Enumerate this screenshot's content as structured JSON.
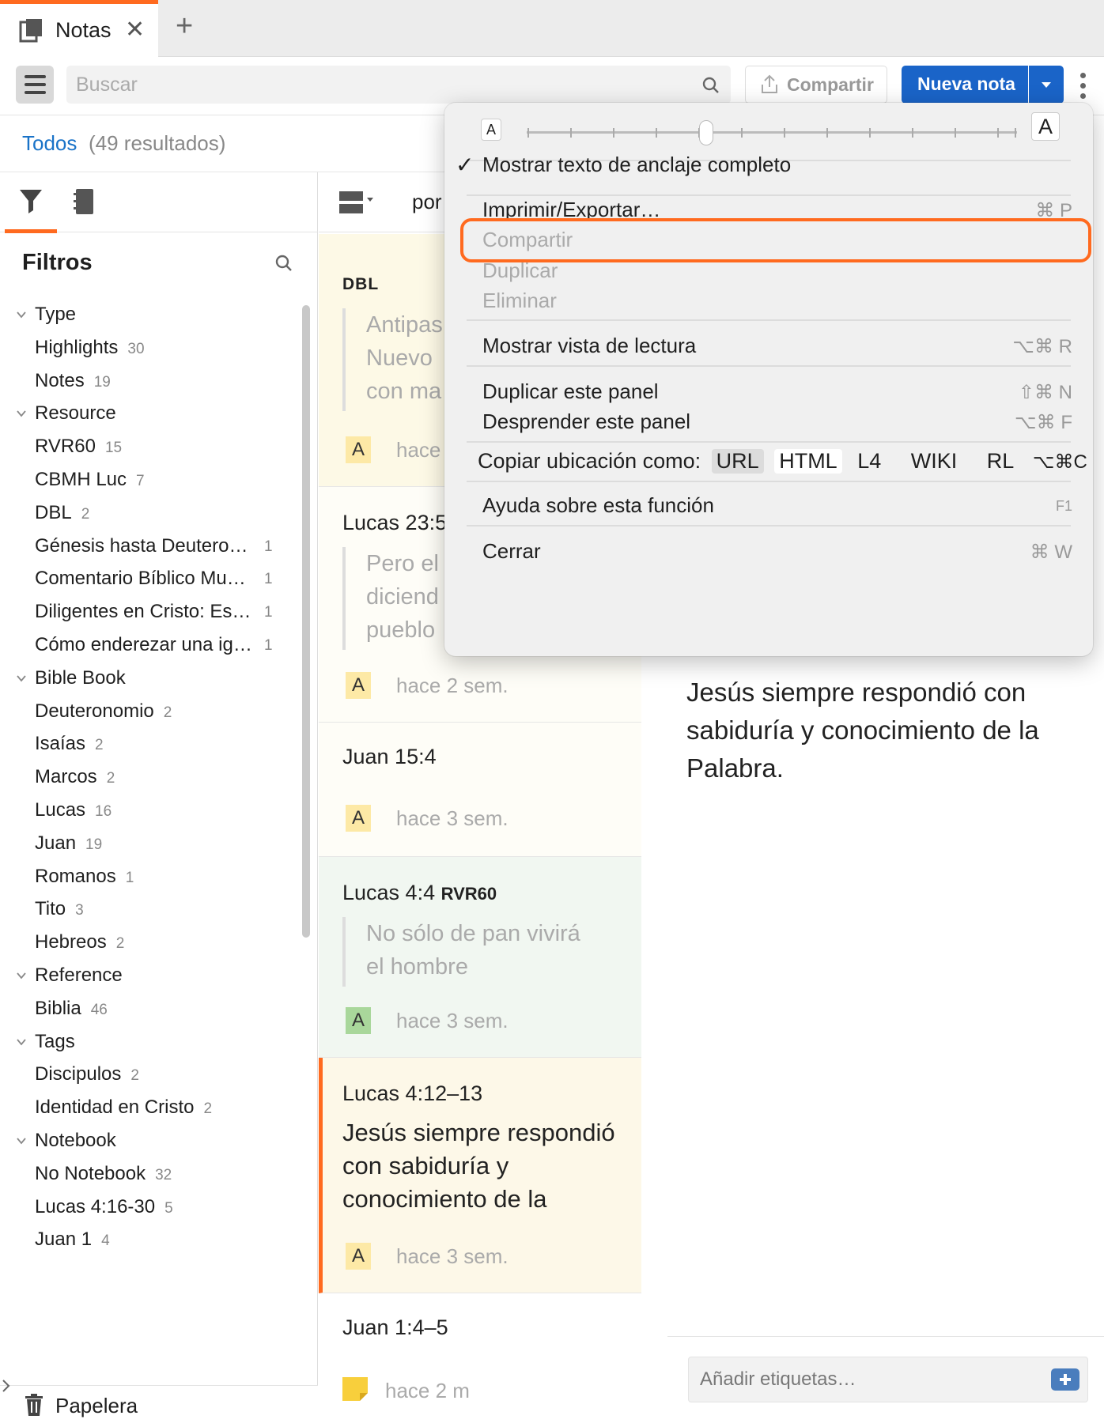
{
  "tab": {
    "title": "Notas",
    "close": "✕",
    "new": "+"
  },
  "toolbar": {
    "search_placeholder": "Buscar",
    "share_label": "Compartir",
    "new_note_label": "Nueva nota"
  },
  "scope": {
    "label": "Todos",
    "count": "(49 resultados)"
  },
  "sidebar": {
    "title": "Filtros",
    "trash_label": "Papelera",
    "groups": [
      {
        "label": "Type",
        "items": [
          {
            "label": "Highlights",
            "count": "30"
          },
          {
            "label": "Notes",
            "count": "19"
          }
        ]
      },
      {
        "label": "Resource",
        "items": [
          {
            "label": "RVR60",
            "count": "15"
          },
          {
            "label": "CBMH Luc",
            "count": "7"
          },
          {
            "label": "DBL",
            "count": "2"
          },
          {
            "label": "Génesis hasta Deutero…",
            "count": "1"
          },
          {
            "label": "Comentario Bíblico Mu…",
            "count": "1"
          },
          {
            "label": "Diligentes en Cristo: Es…",
            "count": "1"
          },
          {
            "label": "Cómo enderezar una ig…",
            "count": "1"
          }
        ]
      },
      {
        "label": "Bible Book",
        "items": [
          {
            "label": "Deuteronomio",
            "count": "2"
          },
          {
            "label": "Isaías",
            "count": "2"
          },
          {
            "label": "Marcos",
            "count": "2"
          },
          {
            "label": "Lucas",
            "count": "16"
          },
          {
            "label": "Juan",
            "count": "19"
          },
          {
            "label": "Romanos",
            "count": "1"
          },
          {
            "label": "Tito",
            "count": "3"
          },
          {
            "label": "Hebreos",
            "count": "2"
          }
        ]
      },
      {
        "label": "Reference",
        "items": [
          {
            "label": "Biblia",
            "count": "46"
          }
        ]
      },
      {
        "label": "Tags",
        "items": [
          {
            "label": "Discipulos",
            "count": "2"
          },
          {
            "label": "Identidad en Cristo",
            "count": "2"
          }
        ]
      },
      {
        "label": "Notebook",
        "items": [
          {
            "label": "No Notebook",
            "count": "32"
          },
          {
            "label": "Lucas 4:16-30",
            "count": "5"
          },
          {
            "label": "Juan 1",
            "count": "4"
          }
        ]
      }
    ]
  },
  "list": {
    "sort_label": "por",
    "cards": [
      {
        "ref": "DBL",
        "quote": [
          "Antipas",
          "Nuevo",
          "con ma"
        ],
        "badge": "A",
        "when": "hace"
      },
      {
        "ref": "Lucas 23:5",
        "quote": [
          "Pero el",
          "diciend",
          "pueblo"
        ],
        "badge": "A",
        "when": "hace 2 sem."
      },
      {
        "ref": "Juan 15:4",
        "badge": "A",
        "when": "hace 3 sem."
      },
      {
        "ref": "Lucas 4:4",
        "ref_tag": "RVR60",
        "quote": [
          "No sólo de pan vivirá",
          "el hombre"
        ],
        "badge": "A",
        "when": "hace 3 sem."
      },
      {
        "ref": "Lucas 4:12–13",
        "body": [
          "Jesús siempre respondió",
          "con sabiduría y",
          "conocimiento de la"
        ],
        "badge": "A",
        "when": "hace 3 sem."
      },
      {
        "ref": "Juan 1:4–5",
        "when": "hace 2 m"
      }
    ]
  },
  "detail": {
    "text": "Jesús siempre respondió con sabiduría y conocimiento de la Palabra.",
    "tags_placeholder": "Añadir etiquetas…"
  },
  "menu": {
    "font_small": "A",
    "font_large": "A",
    "show_anchor": "Mostrar texto de anclaje completo",
    "check": "✓",
    "print": "Imprimir/Exportar…",
    "print_sc": "⌘ P",
    "share": "Compartir",
    "duplicate": "Duplicar",
    "delete": "Eliminar",
    "reading": "Mostrar vista de lectura",
    "reading_sc": "⌥⌘ R",
    "dup_panel": "Duplicar este panel",
    "dup_panel_sc": "⇧⌘ N",
    "detach": "Desprender este panel",
    "detach_sc": "⌥⌘ F",
    "copy_loc": "Copiar ubicación como:",
    "copy_opts": [
      "URL",
      "HTML",
      "L4",
      "WIKI",
      "RL",
      "⌥⌘C"
    ],
    "help": "Ayuda sobre esta función",
    "help_sc": "F1",
    "close": "Cerrar",
    "close_sc": "⌘ W"
  },
  "colors": {
    "accent": "#ff6a1f",
    "primary": "#1a64c8",
    "link": "#1a73c8",
    "highlight_yellow": "#fdf9e6",
    "highlight_green": "#f1f7f1"
  }
}
